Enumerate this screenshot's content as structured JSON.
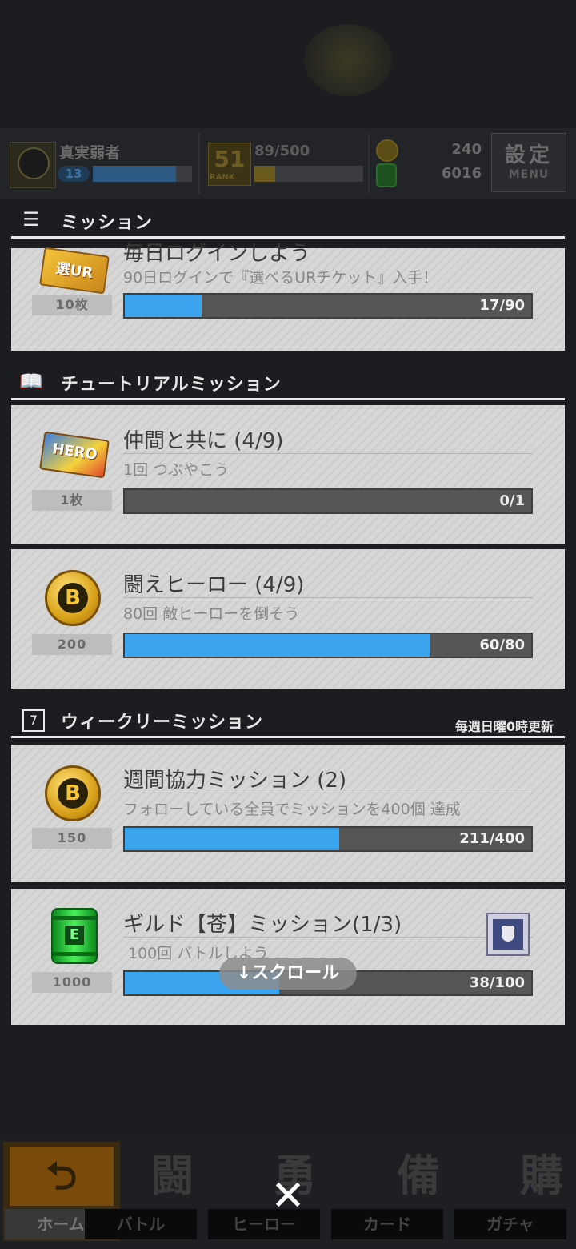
{
  "status": {
    "player_name": "真実弱者",
    "level": "13",
    "rank_number": "51",
    "rank_label": "RANK",
    "stamina": "89/500",
    "coins": "240",
    "gems": "6016",
    "menu_top": "設定",
    "menu_bottom": "MENU"
  },
  "sections": {
    "mission": {
      "title": "ミッション",
      "icon": "document-icon"
    },
    "tutorial": {
      "title": "チュートリアルミッション",
      "icon": "book-icon"
    },
    "weekly": {
      "title": "ウィークリーミッション",
      "icon": "calendar-icon",
      "note": "毎週日曜0時更新",
      "calendar_day": "7"
    }
  },
  "missions": [
    {
      "title": "毎日ログインしよう",
      "desc": "90日ログインで『選べるURチケット』入手！",
      "reward_icon": "ur-ticket-icon",
      "reward_icon_text": "選UR",
      "reward_count": "10枚",
      "progress_text": "17/90",
      "progress": 0.189
    },
    {
      "title": "仲間と共に (4/9)",
      "desc": "1回 つぶやこう",
      "reward_icon": "hero-ticket-icon",
      "reward_icon_text": "HERO",
      "reward_count": "1枚",
      "progress_text": "0/1",
      "progress": 0
    },
    {
      "title": "闘えヒーロー (4/9)",
      "desc": "80回 敵ヒーローを倒そう",
      "reward_icon": "coin-icon",
      "reward_icon_text": "B",
      "reward_count": "200",
      "progress_text": "60/80",
      "progress": 0.75
    },
    {
      "title": "週間協力ミッション (2)",
      "desc": "フォローしている全員でミッションを400個 達成",
      "reward_icon": "coin-icon",
      "reward_icon_text": "B",
      "reward_count": "150",
      "progress_text": "211/400",
      "progress": 0.5275
    },
    {
      "title": "ギルド【苍】ミッション(1/3)",
      "desc": "100回 バトルしよう",
      "reward_icon": "green-barrel-icon",
      "reward_icon_text": "E",
      "reward_count": "1000",
      "progress_text": "38/100",
      "progress": 0.38
    }
  ],
  "scroll_hint": "↓スクロール",
  "nav": [
    {
      "label": "ホーム",
      "glyph": "⮌"
    },
    {
      "label": "バトル",
      "glyph": "闘"
    },
    {
      "label": "ヒーロー",
      "glyph": "勇"
    },
    {
      "label": "カード",
      "glyph": "備"
    },
    {
      "label": "ガチャ",
      "glyph": "購"
    }
  ],
  "close_glyph": "✕",
  "colors": {
    "progress_fill": "#3aa4ee",
    "progress_track": "#555555",
    "background": "#1b1d20"
  }
}
